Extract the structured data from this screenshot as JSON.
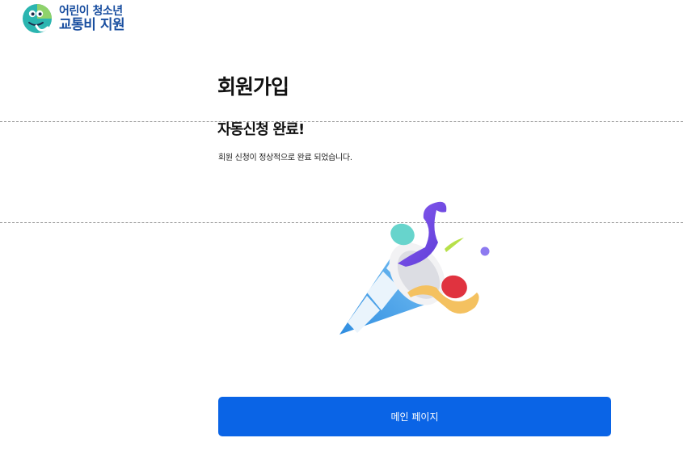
{
  "header": {
    "logo_line1": "어린이 청소년",
    "logo_line2": "교통비 지원"
  },
  "main": {
    "title": "회원가입",
    "complete_title": "자동신청 완료!",
    "complete_message": "회원 신청이 정상적으로 완료 되었습니다.",
    "main_page_button": "메인 페이지"
  },
  "illustration": {
    "icon": "party-popper-icon"
  },
  "colors": {
    "primary_button": "#0a64e6",
    "logo_text": "#1a4fa0",
    "logo_teal": "#2bb5b0",
    "logo_green": "#8fd26b"
  }
}
